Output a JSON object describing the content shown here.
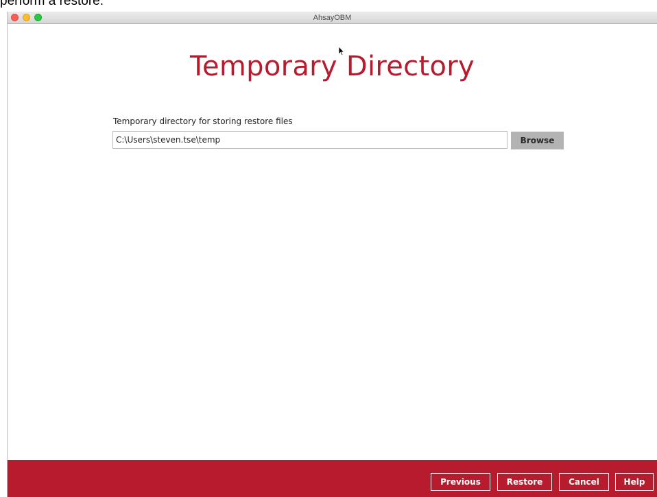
{
  "document_text": {
    "top_fragment": "perform a restore."
  },
  "window": {
    "title": "AhsayOBM"
  },
  "main": {
    "page_title": "Temporary Directory",
    "field_label": "Temporary directory for storing restore files",
    "path_value": "C:\\Users\\steven.tse\\temp",
    "browse_label": "Browse"
  },
  "footer": {
    "previous_label": "Previous",
    "restore_label": "Restore",
    "cancel_label": "Cancel",
    "help_label": "Help"
  },
  "colors": {
    "brand_red": "#b71c2e",
    "browse_gray": "#b3b3b3"
  },
  "icons": {
    "cursor": "arrow-cursor-icon"
  }
}
